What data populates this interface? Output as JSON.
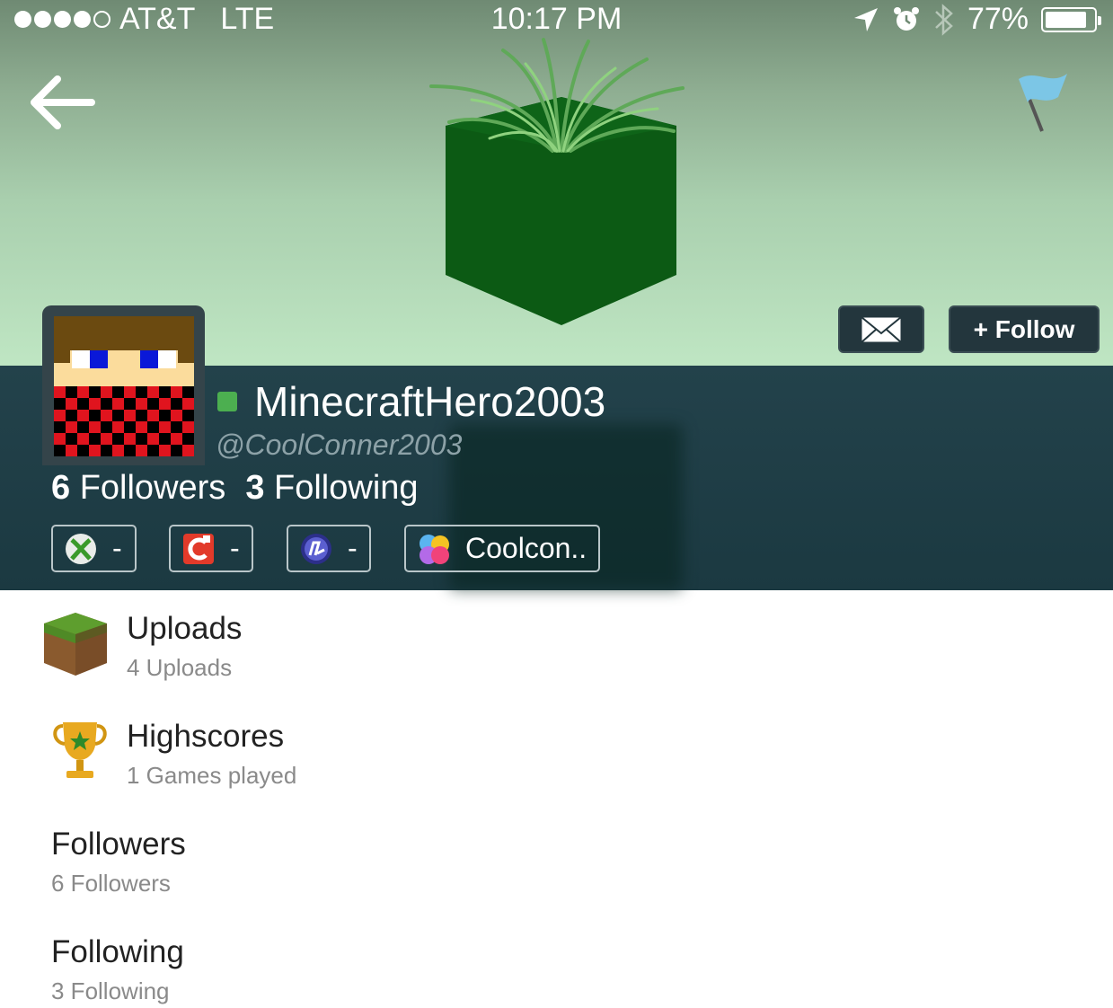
{
  "status_bar": {
    "carrier": "AT&T",
    "network": "LTE",
    "time": "10:17 PM",
    "battery_percent": "77%",
    "battery_level": 0.77,
    "signal_bars": 4,
    "signal_total": 5,
    "icons": [
      "location-arrow-icon",
      "alarm-icon",
      "bluetooth-icon",
      "battery-icon"
    ]
  },
  "header": {
    "back_icon": "arrow-left-icon",
    "report_icon": "flag-icon",
    "message_icon": "envelope-icon",
    "follow_label": "+ Follow"
  },
  "profile": {
    "display_name": "MinecraftHero2003",
    "handle": "@CoolConner2003",
    "online_color": "#4caf50",
    "followers_count": "6",
    "followers_label": "Followers",
    "following_count": "3",
    "following_label": "Following"
  },
  "platforms": [
    {
      "icon": "xbox-icon",
      "value": "-"
    },
    {
      "icon": "nintendo-icon",
      "value": "-"
    },
    {
      "icon": "playstation-icon",
      "value": "-"
    },
    {
      "icon": "game-center-icon",
      "value": "Coolcon.."
    }
  ],
  "menu": [
    {
      "title": "Uploads",
      "subtitle": "4 Uploads",
      "icon": "grass-block-icon"
    },
    {
      "title": "Highscores",
      "subtitle": "1 Games played",
      "icon": "trophy-icon"
    },
    {
      "title": "Followers",
      "subtitle": "6 Followers"
    },
    {
      "title": "Following",
      "subtitle": "3 Following"
    }
  ],
  "colors": {
    "banner_top": "#6f8a73",
    "banner_bottom": "#bfe6c3",
    "profile_band": "#1f3e46",
    "button_bg": "#23363d"
  }
}
